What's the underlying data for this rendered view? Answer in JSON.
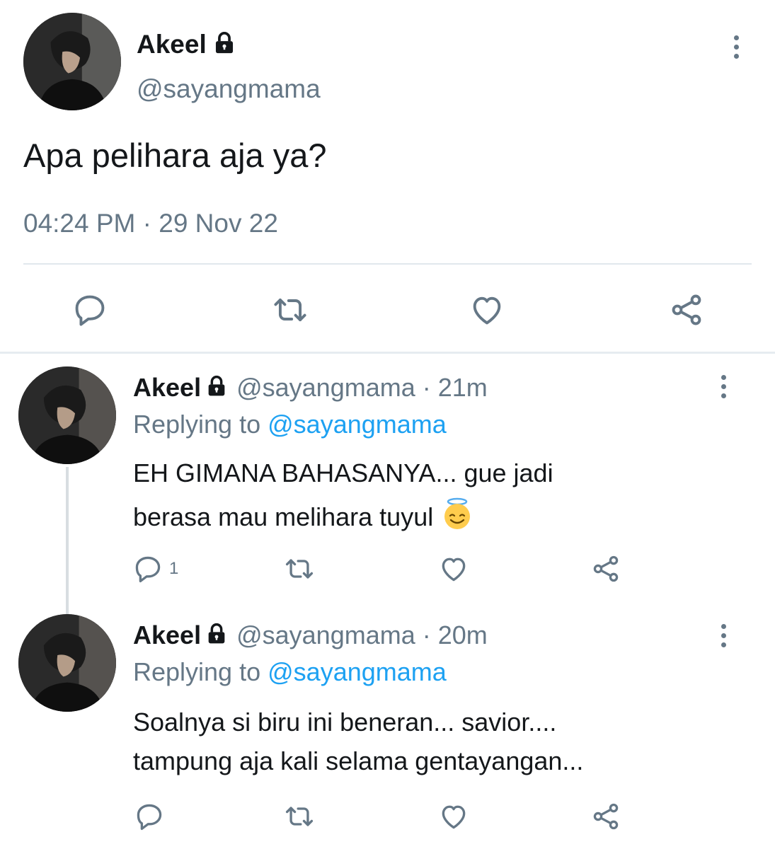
{
  "main_tweet": {
    "author_name": "Akeel",
    "author_handle": "@sayangmama",
    "text": "Apa pelihara aja ya?",
    "timestamp": "04:24 PM · 29 Nov 22",
    "icons": [
      "reply-icon",
      "retweet-icon",
      "like-icon",
      "share-icon"
    ]
  },
  "replies": [
    {
      "author_name": "Akeel",
      "meta": "@sayangmama · 21m",
      "replying_prefix": "Replying to",
      "replying_to": "@sayangmama",
      "text_line1": "EH GIMANA BAHASANYA... gue jadi",
      "text_line2": "berasa mau melihara tuyul",
      "emoji": "smiling-face-with-halo",
      "reply_count": "1"
    },
    {
      "author_name": "Akeel",
      "meta": "@sayangmama · 20m",
      "replying_prefix": "Replying to",
      "replying_to": "@sayangmama",
      "text_line1": "Soalnya si biru ini beneran... savior....",
      "text_line2": "tampung aja kali selama gentayangan...",
      "reply_count": ""
    }
  ],
  "colors": {
    "text": "#14171a",
    "muted": "#657786",
    "link": "#1da1f2",
    "divider": "#e1e8ed"
  }
}
